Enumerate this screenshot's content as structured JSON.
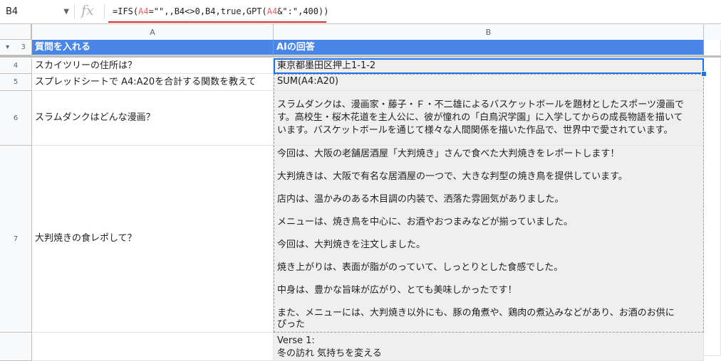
{
  "formula_bar": {
    "cell_ref": "B4",
    "fx": "fx",
    "formula_parts": [
      {
        "text": "=IFS(",
        "ref": false
      },
      {
        "text": "A4",
        "ref": true
      },
      {
        "text": "=\"\",,B4<>0,B4,true,GPT(",
        "ref": false
      },
      {
        "text": "A4",
        "ref": true
      },
      {
        "text": "&\":\",400))",
        "ref": false
      }
    ]
  },
  "columns": [
    "A",
    "B"
  ],
  "rows": [
    {
      "num": "3",
      "a": "質問を入れる",
      "b_lines": [
        "AIの回答"
      ],
      "header": true
    },
    {
      "num": "4",
      "a": "スカイツリーの住所は？",
      "b_lines": [
        "東京都墨田区押上1-1-2"
      ]
    },
    {
      "num": "5",
      "a": "スプレッドシートで A4:A20を合計する関数を教えて",
      "b_lines": [
        "SUM(A4:A20)"
      ]
    },
    {
      "num": "6",
      "a": "スラムダンクはどんな漫画？",
      "b_lines": [
        "スラムダンクは、漫画家・藤子・Ｆ・不二雄によるバスケットボールを題材としたスポーツ漫画で",
        "す。高校生・桜木花道を主人公に、彼が憧れの「白鳥沢学園」に入学してからの成長物語を描いて",
        "います。バスケットボールを通じて様々な人間関係を描いた作品で、世界中で愛されています。"
      ]
    },
    {
      "num": "7",
      "a": "大判焼きの食レポして？",
      "b_lines": [
        "今回は、大阪の老舗居酒屋「大判焼き」さんで食べた大判焼きをレポートします！",
        "",
        "大判焼きは、大阪で有名な居酒屋の一つで、大きな判型の焼き鳥を提供しています。",
        "",
        "店内は、温かみのある木目調の内装で、洒落た雰囲気がありました。",
        "",
        "メニューは、焼き鳥を中心に、お酒やおつまみなどが揃っていました。",
        "",
        "今回は、大判焼きを注文しました。",
        "",
        "焼き上がりは、表面が脂がのっていて、しっとりとした食感でした。",
        "",
        "中身は、豊かな旨味が広がり、とても美味しかったです！",
        "",
        "また、メニューには、大判焼き以外にも、豚の角煮や、鶏肉の煮込みなどがあり、お酒のお供に",
        "ぴった"
      ]
    },
    {
      "num": "",
      "a": "",
      "b_lines": [
        "Verse 1:",
        "  冬の訪れ 気持ちを変える"
      ]
    }
  ]
}
